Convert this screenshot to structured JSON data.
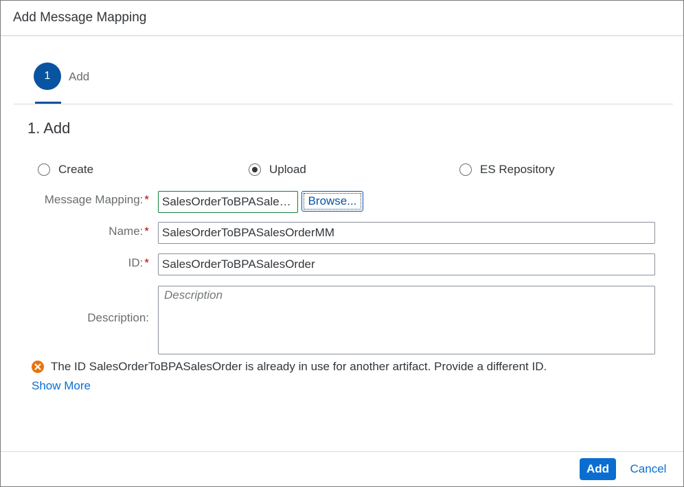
{
  "dialog": {
    "title": "Add Message Mapping"
  },
  "wizard": {
    "step_number": "1",
    "step_label": "Add"
  },
  "section": {
    "title": "1. Add"
  },
  "source_options": [
    {
      "label": "Create",
      "selected": false
    },
    {
      "label": "Upload",
      "selected": true
    },
    {
      "label": "ES Repository",
      "selected": false
    }
  ],
  "form": {
    "message_mapping": {
      "label": "Message Mapping:",
      "required_mark": "*",
      "value": "SalesOrderToBPASalesOrderMM.mmap",
      "display_value": "SalesOrderToBPASales...",
      "browse_label": "Browse..."
    },
    "name": {
      "label": "Name:",
      "required_mark": "*",
      "value": "SalesOrderToBPASalesOrderMM"
    },
    "id": {
      "label": "ID:",
      "required_mark": "*",
      "value": "SalesOrderToBPASalesOrder"
    },
    "description": {
      "label": "Description:",
      "placeholder": "Description",
      "value": ""
    }
  },
  "error": {
    "icon": "error-circle-icon",
    "message": "The ID SalesOrderToBPASalesOrder is already in use for another artifact. Provide a different ID.",
    "show_more_label": "Show More",
    "color": "#e9730c"
  },
  "footer": {
    "add_label": "Add",
    "cancel_label": "Cancel"
  },
  "colors": {
    "brand": "#0854a0",
    "emphasized_button": "#0a6ed1",
    "required": "#bb0000",
    "success_border": "#107e3e"
  }
}
